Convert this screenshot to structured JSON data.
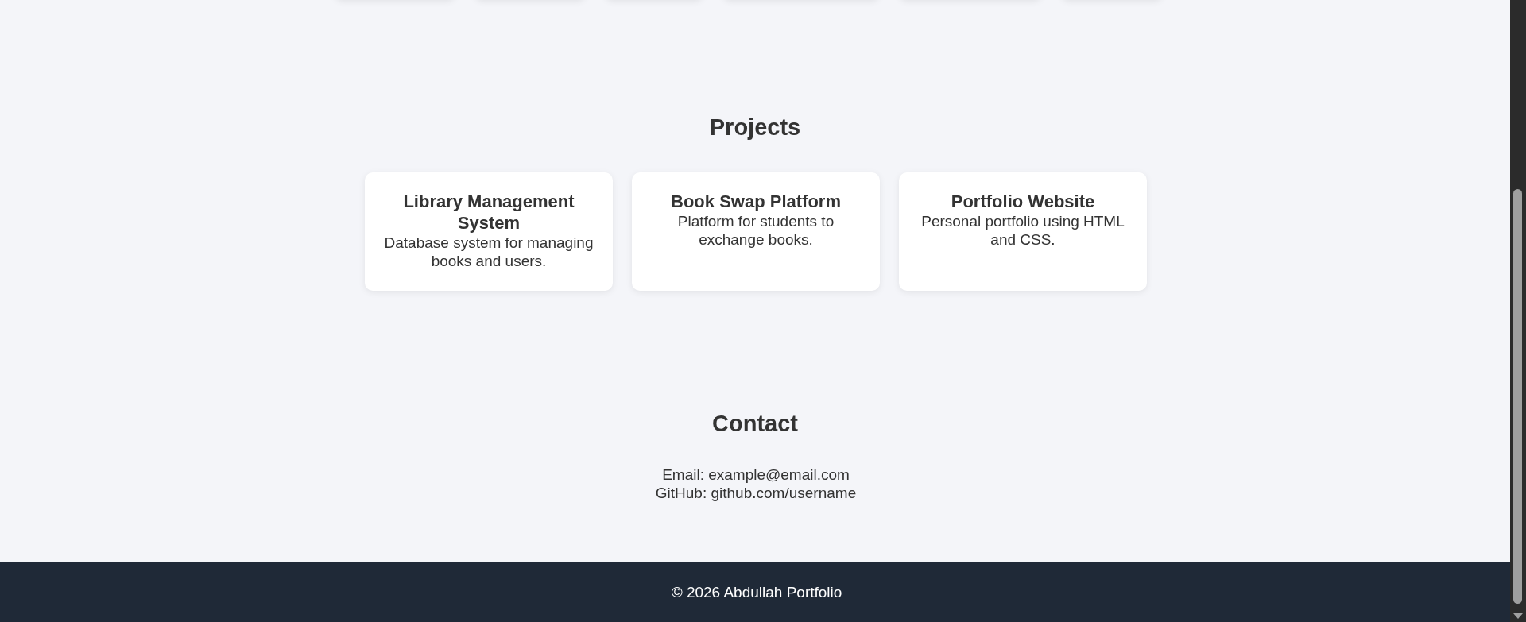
{
  "projects": {
    "heading": "Projects",
    "cards": [
      {
        "title": "Library Management System",
        "description": "Database system for managing books and users."
      },
      {
        "title": "Book Swap Platform",
        "description": "Platform for students to exchange books."
      },
      {
        "title": "Portfolio Website",
        "description": "Personal portfolio using HTML and CSS."
      }
    ]
  },
  "contact": {
    "heading": "Contact",
    "lines": [
      "Email: example@email.com",
      "GitHub: github.com/username"
    ]
  },
  "footer": {
    "text": "© 2026 Abdullah Portfolio"
  }
}
